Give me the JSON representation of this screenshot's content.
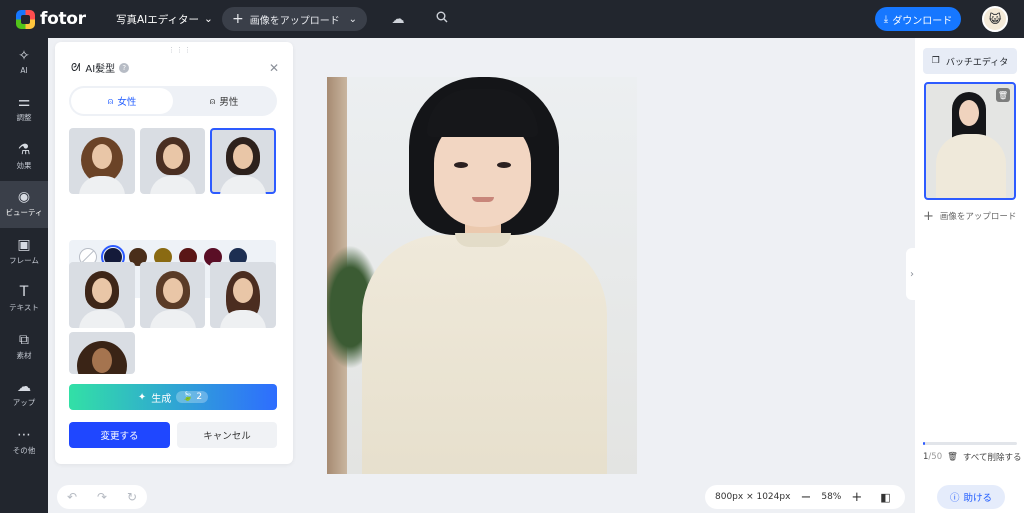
{
  "app": {
    "logo_text": "fotor",
    "editor_mode": "写真AIエディター",
    "upload_label": "画像をアップロード",
    "download_label": "ダウンロード"
  },
  "sidebar": {
    "items": [
      {
        "label": "AI",
        "icon": "sparkle-icon"
      },
      {
        "label": "調整",
        "icon": "sliders-icon"
      },
      {
        "label": "効果",
        "icon": "flask-icon"
      },
      {
        "label": "ビューティ",
        "icon": "eye-icon",
        "active": true
      },
      {
        "label": "フレーム",
        "icon": "frame-icon"
      },
      {
        "label": "テキスト",
        "icon": "text-icon"
      },
      {
        "label": "素材",
        "icon": "shapes-icon"
      },
      {
        "label": "アップ",
        "icon": "cloud-upload-icon"
      },
      {
        "label": "その他",
        "icon": "more-icon"
      }
    ]
  },
  "panel": {
    "title": "AI髪型",
    "tabs": [
      {
        "label": "女性",
        "active": true
      },
      {
        "label": "男性",
        "active": false
      }
    ],
    "hair_colors": [
      "none",
      "#141a3a",
      "#4a2e1a",
      "#8a6a12",
      "#5a1616",
      "#5a0e26",
      "#1d2f52",
      "#1e3a1c",
      "#4a1d5a"
    ],
    "selected_color_index": 1,
    "selected_style_index": 2,
    "generate_label": "生成",
    "generate_credits": "2",
    "apply_label": "変更する",
    "cancel_label": "キャンセル"
  },
  "canvas": {
    "size_readout": "800px × 1024px",
    "zoom_percent": "58%"
  },
  "right_panel": {
    "batch_label": "バッチエディタ",
    "add_image_label": "画像をアップロード",
    "count_current": "1",
    "count_total": "/50",
    "progress_fraction": 0.02,
    "delete_all_label": "すべて削除する",
    "help_label": "助ける"
  },
  "colors": {
    "accent": "#1677ff",
    "topbar": "#22262e"
  }
}
